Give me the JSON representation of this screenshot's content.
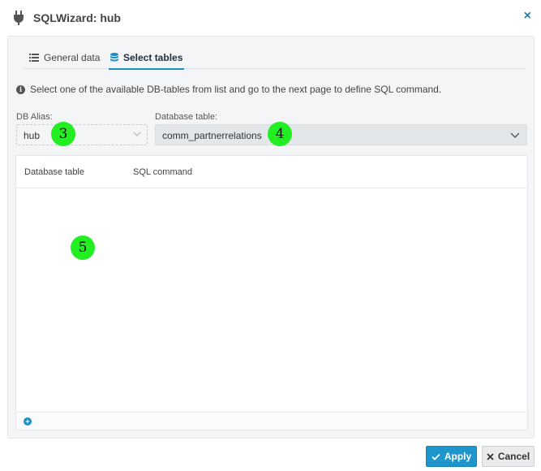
{
  "window": {
    "title": "SQLWizard: hub",
    "icon": "plug-icon",
    "close_label": "×"
  },
  "tabs": [
    {
      "label": "General data",
      "icon": "list-icon",
      "active": false
    },
    {
      "label": "Select tables",
      "icon": "database-icon",
      "active": true
    }
  ],
  "info_text": "Select one of the available DB-tables from list and go to the next page to define SQL command.",
  "db_alias": {
    "label": "DB Alias:",
    "value": "hub"
  },
  "database_table": {
    "label": "Database table:",
    "value": "comm_partnerrelations"
  },
  "grid": {
    "columns": [
      "Database table",
      "SQL command"
    ],
    "rows": []
  },
  "markers": [
    "3",
    "4",
    "5"
  ],
  "buttons": {
    "apply": "Apply",
    "cancel": "Cancel"
  },
  "colors": {
    "accent": "#1e96cc",
    "marker": "#22ee22"
  }
}
